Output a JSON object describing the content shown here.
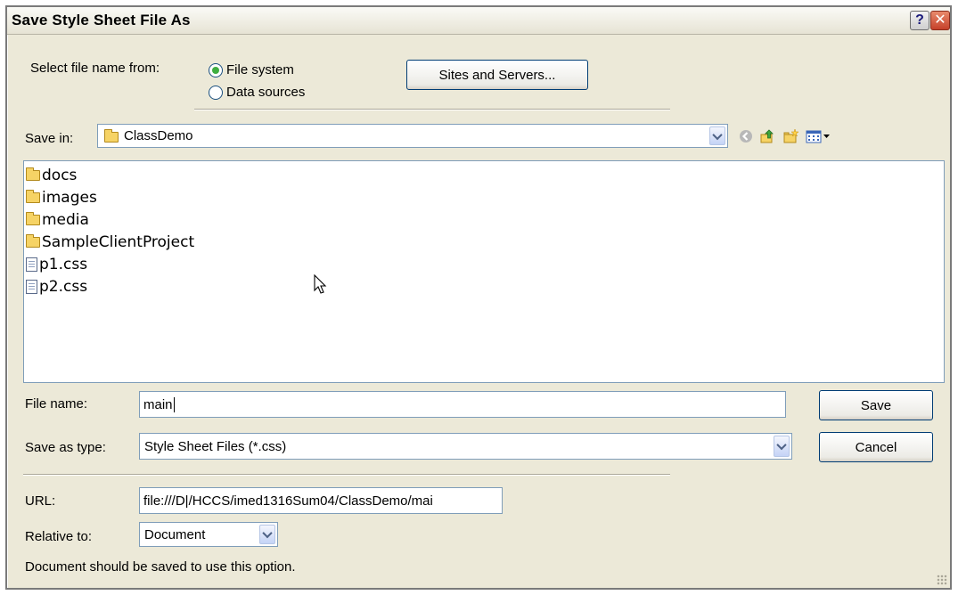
{
  "window": {
    "title": "Save Style Sheet File As",
    "help_glyph": "?",
    "close_glyph": "✕"
  },
  "source": {
    "label": "Select file name from:",
    "options": [
      {
        "label": "File system",
        "selected": true
      },
      {
        "label": "Data sources",
        "selected": false
      }
    ],
    "sites_button": "Sites and Servers..."
  },
  "save_in": {
    "label": "Save in:",
    "value": "ClassDemo"
  },
  "toolbar": {
    "icons": [
      "back-icon",
      "up-folder-icon",
      "new-folder-icon",
      "view-menu-icon"
    ]
  },
  "files": [
    {
      "name": "docs",
      "type": "folder"
    },
    {
      "name": "images",
      "type": "folder"
    },
    {
      "name": "media",
      "type": "folder"
    },
    {
      "name": "SampleClientProject",
      "type": "folder"
    },
    {
      "name": "p1.css",
      "type": "file"
    },
    {
      "name": "p2.css",
      "type": "file"
    }
  ],
  "file_name": {
    "label": "File name:",
    "value": "main"
  },
  "save_as_type": {
    "label": "Save as type:",
    "value": "Style Sheet Files (*.css)"
  },
  "buttons": {
    "save": "Save",
    "cancel": "Cancel"
  },
  "url": {
    "label": "URL:",
    "value": "file:///D|/HCCS/imed1316Sum04/ClassDemo/mai"
  },
  "relative_to": {
    "label": "Relative to:",
    "value": "Document"
  },
  "note": "Document should be saved to use this option.",
  "colors": {
    "dialog_bg": "#ece9d8",
    "field_border": "#7f9db9",
    "radio_selected": "#3fae3f",
    "folder": "#f6d365"
  }
}
